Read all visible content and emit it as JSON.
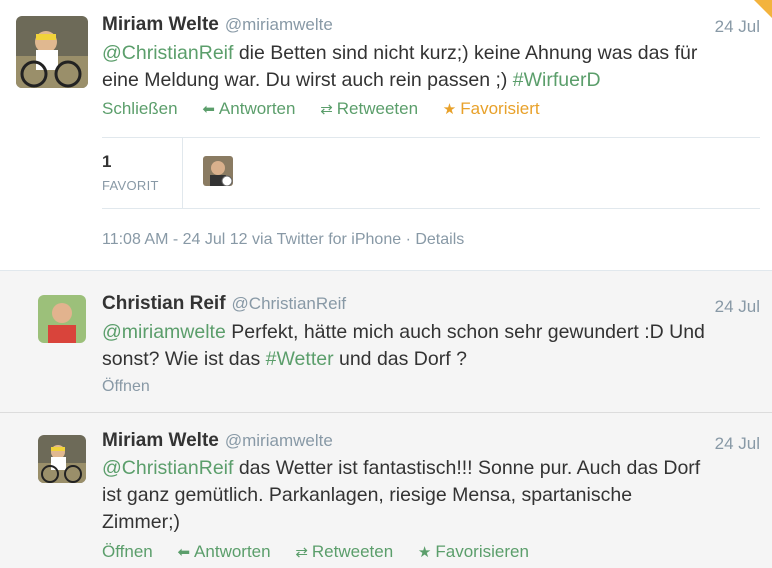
{
  "tweet1": {
    "author_name": "Miriam Welte",
    "author_handle": "@miriamwelte",
    "date": "24 Jul",
    "mention": "@ChristianReif",
    "text_line1": " die Betten sind nicht kurz;) keine Ahnung was das für",
    "text_line2": "eine Meldung war. Du wirst auch rein passen ;) ",
    "hashtag": "#WirfuerD",
    "action_close": "Schließen",
    "action_reply": "Antworten",
    "action_retweet": "Retweeten",
    "action_favorite": "Favorisiert",
    "favorite_count": "1",
    "favorite_label": "FAVORIT",
    "meta": "11:08 AM - 24 Jul 12 via Twitter for iPhone · Details",
    "icon_reply": "reply-arrow-icon",
    "icon_retweet": "retweet-icon",
    "icon_favorite": "star-icon"
  },
  "tweet2": {
    "author_name": "Christian Reif",
    "author_handle": "@ChristianReif",
    "date": "24 Jul",
    "mention": "@miriamwelte",
    "text_line1": " Perfekt, hätte mich auch schon sehr gewundert :D Und",
    "text_line2_a": "sonst? Wie ist das ",
    "hashtag": "#Wetter",
    "text_line2_b": " und das Dorf ?",
    "action_open": "Öffnen"
  },
  "tweet3": {
    "author_name": "Miriam Welte",
    "author_handle": "@miriamwelte",
    "date": "24 Jul",
    "mention": "@ChristianReif",
    "text_line1": " das Wetter ist fantastisch!!! Sonne pur. Auch das Dorf",
    "text_line2": "ist ganz gemütlich. Parkanlagen, riesige Mensa, spartanische",
    "text_line3": "Zimmer;)",
    "action_open": "Öffnen",
    "action_reply": "Antworten",
    "action_retweet": "Retweeten",
    "action_favorite": "Favorisieren"
  },
  "colors": {
    "link": "#5b9e6b",
    "favorited": "#e8a12a",
    "muted": "#8899a6",
    "reply_bg": "#f5f5f5"
  }
}
